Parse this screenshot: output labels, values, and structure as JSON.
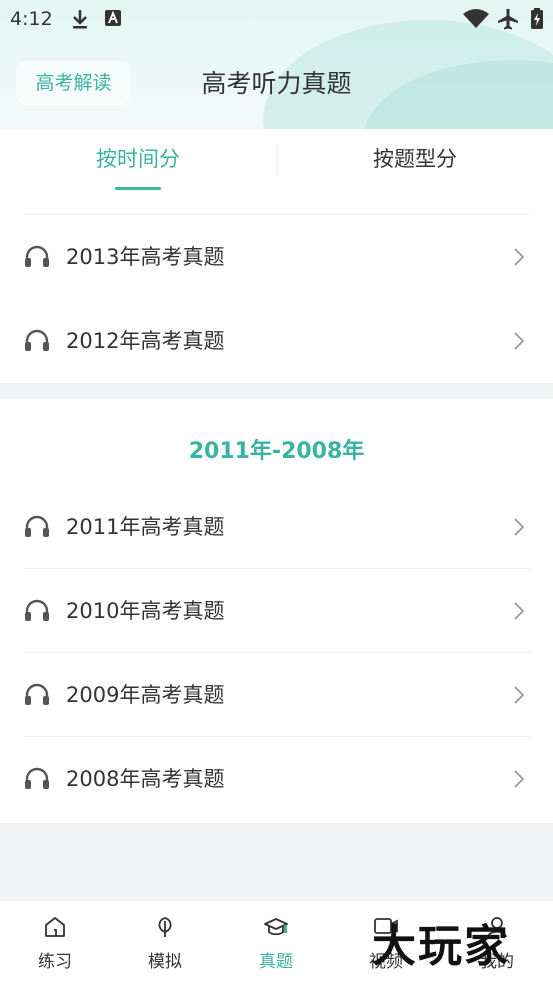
{
  "status_bar": {
    "time": "4:12"
  },
  "header": {
    "chip_label": "高考解读",
    "title": "高考听力真题"
  },
  "tabs": [
    {
      "label": "按时间分",
      "active": true
    },
    {
      "label": "按题型分",
      "active": false
    }
  ],
  "section1": {
    "items": [
      {
        "label": "2013年高考真题"
      },
      {
        "label": "2012年高考真题"
      }
    ]
  },
  "section2": {
    "title": "2011年-2008年",
    "items": [
      {
        "label": "2011年高考真题"
      },
      {
        "label": "2010年高考真题"
      },
      {
        "label": "2009年高考真题"
      },
      {
        "label": "2008年高考真题"
      }
    ]
  },
  "bottom_nav": [
    {
      "label": "练习",
      "icon": "home-icon",
      "active": false
    },
    {
      "label": "模拟",
      "icon": "leaf-icon",
      "active": false
    },
    {
      "label": "真题",
      "icon": "graduation-cap-icon",
      "active": true
    },
    {
      "label": "视频",
      "icon": "video-icon",
      "active": false
    },
    {
      "label": "我的",
      "icon": "user-icon",
      "active": false
    }
  ],
  "watermark": "大玩家",
  "colors": {
    "accent": "#3bb3a4",
    "text": "#333333",
    "background": "#f2f3f5"
  }
}
